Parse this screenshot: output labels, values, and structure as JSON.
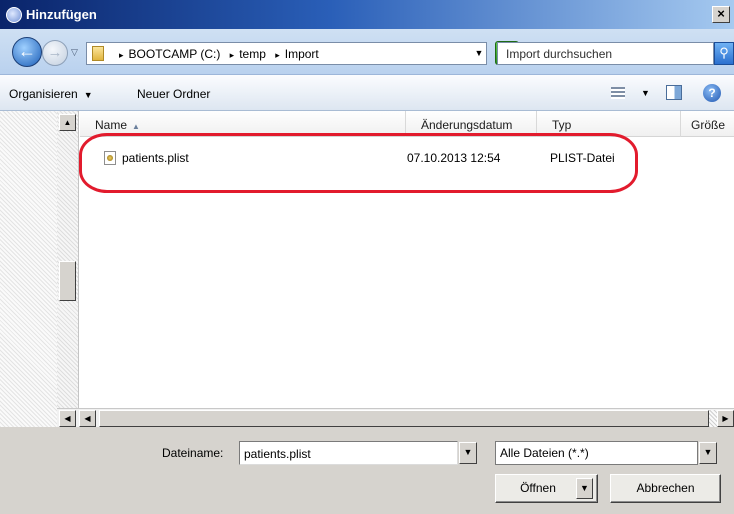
{
  "window": {
    "title": "Hinzufügen",
    "close_glyph": "×"
  },
  "address": {
    "crumbs": [
      "BOOTCAMP (C:)",
      "temp",
      "Import"
    ],
    "crumb_separator": "▸",
    "search_placeholder": "Import durchsuchen"
  },
  "toolbar": {
    "organize_label": "Organisieren",
    "new_folder_label": "Neuer Ordner"
  },
  "columns": [
    "Name",
    "Änderungsdatum",
    "Typ",
    "Größe"
  ],
  "files": [
    {
      "name": "patients.plist",
      "modified": "07.10.2013 12:54",
      "type": "PLIST-Datei",
      "size": ""
    }
  ],
  "footer": {
    "filename_label": "Dateiname:",
    "filename_value": "patients.plist",
    "filetype_value": "Alle Dateien (*.*)",
    "open_label": "Öffnen",
    "cancel_label": "Abbrechen"
  },
  "colors": {
    "highlight": "#e21b2d",
    "title_start": "#0a246a",
    "title_end": "#a6caf0"
  }
}
